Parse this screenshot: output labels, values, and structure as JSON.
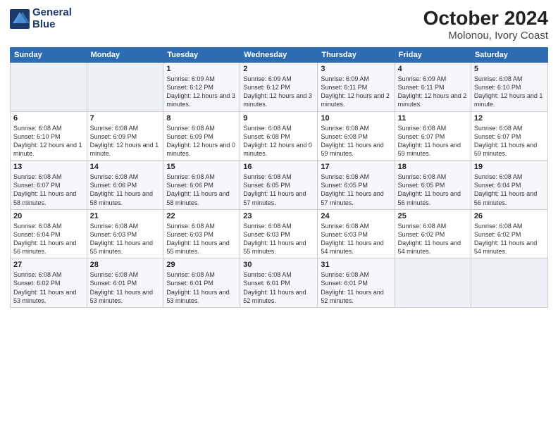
{
  "logo": {
    "line1": "General",
    "line2": "Blue"
  },
  "title": "October 2024",
  "subtitle": "Molonou, Ivory Coast",
  "weekdays": [
    "Sunday",
    "Monday",
    "Tuesday",
    "Wednesday",
    "Thursday",
    "Friday",
    "Saturday"
  ],
  "weeks": [
    [
      {
        "day": "",
        "info": ""
      },
      {
        "day": "",
        "info": ""
      },
      {
        "day": "1",
        "info": "Sunrise: 6:09 AM\nSunset: 6:12 PM\nDaylight: 12 hours\nand 3 minutes."
      },
      {
        "day": "2",
        "info": "Sunrise: 6:09 AM\nSunset: 6:12 PM\nDaylight: 12 hours\nand 3 minutes."
      },
      {
        "day": "3",
        "info": "Sunrise: 6:09 AM\nSunset: 6:11 PM\nDaylight: 12 hours\nand 2 minutes."
      },
      {
        "day": "4",
        "info": "Sunrise: 6:09 AM\nSunset: 6:11 PM\nDaylight: 12 hours\nand 2 minutes."
      },
      {
        "day": "5",
        "info": "Sunrise: 6:08 AM\nSunset: 6:10 PM\nDaylight: 12 hours\nand 1 minute."
      }
    ],
    [
      {
        "day": "6",
        "info": "Sunrise: 6:08 AM\nSunset: 6:10 PM\nDaylight: 12 hours\nand 1 minute."
      },
      {
        "day": "7",
        "info": "Sunrise: 6:08 AM\nSunset: 6:09 PM\nDaylight: 12 hours\nand 1 minute."
      },
      {
        "day": "8",
        "info": "Sunrise: 6:08 AM\nSunset: 6:09 PM\nDaylight: 12 hours\nand 0 minutes."
      },
      {
        "day": "9",
        "info": "Sunrise: 6:08 AM\nSunset: 6:08 PM\nDaylight: 12 hours\nand 0 minutes."
      },
      {
        "day": "10",
        "info": "Sunrise: 6:08 AM\nSunset: 6:08 PM\nDaylight: 11 hours\nand 59 minutes."
      },
      {
        "day": "11",
        "info": "Sunrise: 6:08 AM\nSunset: 6:07 PM\nDaylight: 11 hours\nand 59 minutes."
      },
      {
        "day": "12",
        "info": "Sunrise: 6:08 AM\nSunset: 6:07 PM\nDaylight: 11 hours\nand 59 minutes."
      }
    ],
    [
      {
        "day": "13",
        "info": "Sunrise: 6:08 AM\nSunset: 6:07 PM\nDaylight: 11 hours\nand 58 minutes."
      },
      {
        "day": "14",
        "info": "Sunrise: 6:08 AM\nSunset: 6:06 PM\nDaylight: 11 hours\nand 58 minutes."
      },
      {
        "day": "15",
        "info": "Sunrise: 6:08 AM\nSunset: 6:06 PM\nDaylight: 11 hours\nand 58 minutes."
      },
      {
        "day": "16",
        "info": "Sunrise: 6:08 AM\nSunset: 6:05 PM\nDaylight: 11 hours\nand 57 minutes."
      },
      {
        "day": "17",
        "info": "Sunrise: 6:08 AM\nSunset: 6:05 PM\nDaylight: 11 hours\nand 57 minutes."
      },
      {
        "day": "18",
        "info": "Sunrise: 6:08 AM\nSunset: 6:05 PM\nDaylight: 11 hours\nand 56 minutes."
      },
      {
        "day": "19",
        "info": "Sunrise: 6:08 AM\nSunset: 6:04 PM\nDaylight: 11 hours\nand 56 minutes."
      }
    ],
    [
      {
        "day": "20",
        "info": "Sunrise: 6:08 AM\nSunset: 6:04 PM\nDaylight: 11 hours\nand 56 minutes."
      },
      {
        "day": "21",
        "info": "Sunrise: 6:08 AM\nSunset: 6:03 PM\nDaylight: 11 hours\nand 55 minutes."
      },
      {
        "day": "22",
        "info": "Sunrise: 6:08 AM\nSunset: 6:03 PM\nDaylight: 11 hours\nand 55 minutes."
      },
      {
        "day": "23",
        "info": "Sunrise: 6:08 AM\nSunset: 6:03 PM\nDaylight: 11 hours\nand 55 minutes."
      },
      {
        "day": "24",
        "info": "Sunrise: 6:08 AM\nSunset: 6:03 PM\nDaylight: 11 hours\nand 54 minutes."
      },
      {
        "day": "25",
        "info": "Sunrise: 6:08 AM\nSunset: 6:02 PM\nDaylight: 11 hours\nand 54 minutes."
      },
      {
        "day": "26",
        "info": "Sunrise: 6:08 AM\nSunset: 6:02 PM\nDaylight: 11 hours\nand 54 minutes."
      }
    ],
    [
      {
        "day": "27",
        "info": "Sunrise: 6:08 AM\nSunset: 6:02 PM\nDaylight: 11 hours\nand 53 minutes."
      },
      {
        "day": "28",
        "info": "Sunrise: 6:08 AM\nSunset: 6:01 PM\nDaylight: 11 hours\nand 53 minutes."
      },
      {
        "day": "29",
        "info": "Sunrise: 6:08 AM\nSunset: 6:01 PM\nDaylight: 11 hours\nand 53 minutes."
      },
      {
        "day": "30",
        "info": "Sunrise: 6:08 AM\nSunset: 6:01 PM\nDaylight: 11 hours\nand 52 minutes."
      },
      {
        "day": "31",
        "info": "Sunrise: 6:08 AM\nSunset: 6:01 PM\nDaylight: 11 hours\nand 52 minutes."
      },
      {
        "day": "",
        "info": ""
      },
      {
        "day": "",
        "info": ""
      }
    ]
  ]
}
